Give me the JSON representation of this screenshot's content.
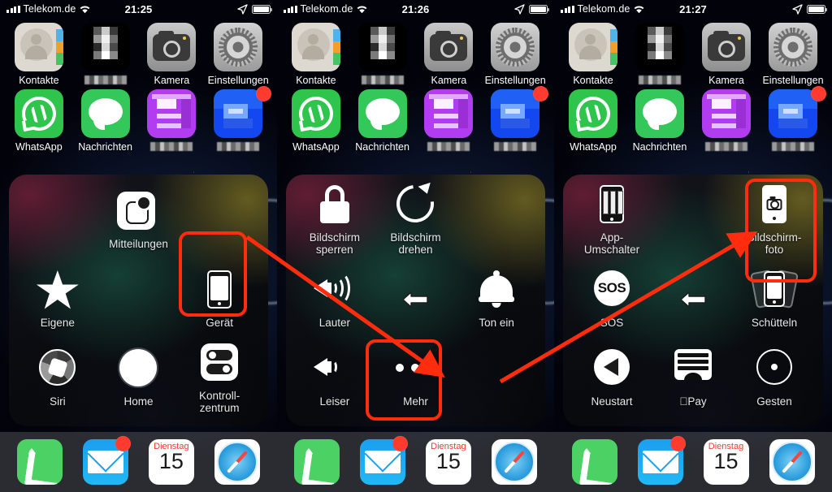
{
  "screens": [
    {
      "status": {
        "carrier": "Telekom.de",
        "time": "21:25",
        "signal_icon": "signal-bars-icon",
        "wifi_icon": "wifi-icon",
        "location_icon": "location-arrow-icon",
        "battery_icon": "battery-full-icon"
      },
      "apps": [
        {
          "label": "Kontakte",
          "icon": "contacts-icon",
          "blurred": false,
          "badge": null
        },
        {
          "label": "",
          "icon": "blurred-app-icon",
          "blurred": true,
          "badge": null
        },
        {
          "label": "Kamera",
          "icon": "camera-icon",
          "blurred": false,
          "badge": null
        },
        {
          "label": "Einstellungen",
          "icon": "settings-gear-icon",
          "blurred": false,
          "badge": null
        },
        {
          "label": "WhatsApp",
          "icon": "whatsapp-icon",
          "blurred": false,
          "badge": null
        },
        {
          "label": "Nachrichten",
          "icon": "messages-icon",
          "blurred": false,
          "badge": null
        },
        {
          "label": "",
          "icon": "blurred-purple-app-icon",
          "blurred": true,
          "badge": null
        },
        {
          "label": "",
          "icon": "blurred-blue-app-icon",
          "blurred": true,
          "badge": ""
        }
      ],
      "panel": {
        "name": "assistivetouch-menu-root",
        "items": [
          {
            "label": "",
            "icon": ""
          },
          {
            "label": "Mitteilungen",
            "icon": "notifications-icon"
          },
          {
            "label": "",
            "icon": ""
          },
          {
            "label": "Eigene",
            "icon": "star-icon"
          },
          {
            "label": "",
            "icon": ""
          },
          {
            "label": "Gerät",
            "icon": "device-phone-icon",
            "highlighted": true
          },
          {
            "label": "Siri",
            "icon": "siri-icon"
          },
          {
            "label": "Home",
            "icon": "home-button-icon"
          },
          {
            "label": "Kontroll-\nzentrum",
            "icon": "control-center-icon"
          }
        ]
      },
      "dock": [
        {
          "label": "",
          "icon": "phone-icon",
          "badge": null
        },
        {
          "label": "",
          "icon": "mail-icon",
          "badge": ""
        },
        {
          "label": "",
          "icon": "calendar-icon",
          "badge": null,
          "weekday": "Dienstag",
          "day": "15"
        },
        {
          "label": "",
          "icon": "safari-icon",
          "badge": null
        }
      ]
    },
    {
      "status": {
        "carrier": "Telekom.de",
        "time": "21:26",
        "signal_icon": "signal-bars-icon",
        "wifi_icon": "wifi-icon",
        "location_icon": "location-arrow-icon",
        "battery_icon": "battery-full-icon"
      },
      "apps": [
        {
          "label": "Kontakte",
          "icon": "contacts-icon",
          "blurred": false,
          "badge": null
        },
        {
          "label": "",
          "icon": "blurred-app-icon",
          "blurred": true,
          "badge": null
        },
        {
          "label": "Kamera",
          "icon": "camera-icon",
          "blurred": false,
          "badge": null
        },
        {
          "label": "Einstellungen",
          "icon": "settings-gear-icon",
          "blurred": false,
          "badge": null
        },
        {
          "label": "WhatsApp",
          "icon": "whatsapp-icon",
          "blurred": false,
          "badge": null
        },
        {
          "label": "Nachrichten",
          "icon": "messages-icon",
          "blurred": false,
          "badge": null
        },
        {
          "label": "",
          "icon": "blurred-purple-app-icon",
          "blurred": true,
          "badge": null
        },
        {
          "label": "",
          "icon": "blurred-blue-app-icon",
          "blurred": true,
          "badge": ""
        }
      ],
      "panel": {
        "name": "assistivetouch-menu-device",
        "items": [
          {
            "label": "Bildschirm\nsperren",
            "icon": "lock-icon"
          },
          {
            "label": "Bildschirm\ndrehen",
            "icon": "rotate-screen-icon"
          },
          {
            "label": "Lauter",
            "icon": "volume-up-icon"
          },
          {
            "label": "",
            "icon": "back-arrow-icon"
          },
          {
            "label": "Ton ein",
            "icon": "bell-icon"
          },
          {
            "label": "Leiser",
            "icon": "volume-down-icon"
          },
          {
            "label": "Mehr",
            "icon": "ellipsis-icon",
            "highlighted": true
          }
        ]
      },
      "dock": [
        {
          "label": "",
          "icon": "phone-icon",
          "badge": null
        },
        {
          "label": "",
          "icon": "mail-icon",
          "badge": ""
        },
        {
          "label": "",
          "icon": "calendar-icon",
          "badge": null,
          "weekday": "Dienstag",
          "day": "15"
        },
        {
          "label": "",
          "icon": "safari-icon",
          "badge": null
        }
      ]
    },
    {
      "status": {
        "carrier": "Telekom.de",
        "time": "21:27",
        "signal_icon": "signal-bars-icon",
        "wifi_icon": "wifi-icon",
        "location_icon": "location-arrow-icon",
        "battery_icon": "battery-full-icon"
      },
      "apps": [
        {
          "label": "Kontakte",
          "icon": "contacts-icon",
          "blurred": false,
          "badge": null
        },
        {
          "label": "",
          "icon": "blurred-app-icon",
          "blurred": true,
          "badge": null
        },
        {
          "label": "Kamera",
          "icon": "camera-icon",
          "blurred": false,
          "badge": null
        },
        {
          "label": "Einstellungen",
          "icon": "settings-gear-icon",
          "blurred": false,
          "badge": null
        },
        {
          "label": "WhatsApp",
          "icon": "whatsapp-icon",
          "blurred": false,
          "badge": null
        },
        {
          "label": "Nachrichten",
          "icon": "messages-icon",
          "blurred": false,
          "badge": null
        },
        {
          "label": "",
          "icon": "blurred-purple-app-icon",
          "blurred": true,
          "badge": null
        },
        {
          "label": "",
          "icon": "blurred-blue-app-icon",
          "blurred": true,
          "badge": ""
        }
      ],
      "panel": {
        "name": "assistivetouch-menu-more",
        "items": [
          {
            "label": "App-\nUmschalter",
            "icon": "app-switcher-icon"
          },
          {
            "label": "Bildschirm-\nfoto",
            "icon": "screenshot-icon",
            "highlighted": true
          },
          {
            "label": "SOS",
            "icon": "sos-icon"
          },
          {
            "label": "",
            "icon": "back-arrow-icon"
          },
          {
            "label": "Schütteln",
            "icon": "shake-icon"
          },
          {
            "label": "Neustart",
            "icon": "restart-icon"
          },
          {
            "label": "Pay",
            "icon": "apple-pay-icon"
          },
          {
            "label": "Gesten",
            "icon": "gestures-icon"
          }
        ]
      },
      "dock": [
        {
          "label": "",
          "icon": "phone-icon",
          "badge": null
        },
        {
          "label": "",
          "icon": "mail-icon",
          "badge": ""
        },
        {
          "label": "",
          "icon": "calendar-icon",
          "badge": null,
          "weekday": "Dienstag",
          "day": "15"
        },
        {
          "label": "",
          "icon": "safari-icon",
          "badge": null
        }
      ]
    }
  ],
  "annotations": {
    "highlight_color": "#ff2d0e",
    "arrows": [
      {
        "name": "arrow-geraet-to-mehr",
        "from": "Gerät",
        "to": "Mehr"
      },
      {
        "name": "arrow-mehr-to-bildschirmfoto",
        "from": "Mehr",
        "to": "Bildschirm-foto"
      }
    ]
  },
  "sos_text": "SOS",
  "apple_logo": "",
  "back_arrow_label": ""
}
